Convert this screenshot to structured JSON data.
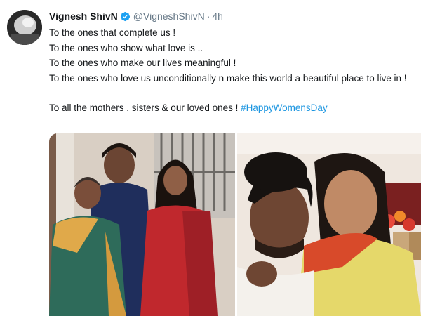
{
  "tweet": {
    "author_name": "Vignesh ShivN",
    "handle": "@VigneshShivN",
    "separator": "·",
    "time": "4h",
    "lines": [
      "To the ones that complete us !",
      "To the ones who show what love is ..",
      "To the ones who make our lives meaningful !",
      "To the ones who love us unconditionally n make this world a beautiful place to live in !"
    ],
    "closing_text": "To all the mothers . sisters & our loved ones ! ",
    "hashtag": "#HappyWomensDay"
  },
  "colors": {
    "hashtag": "#1b95e0",
    "verified": "#1da1f2",
    "secondary_text": "#657786"
  },
  "icons": {
    "verified": "verified-badge-icon"
  }
}
